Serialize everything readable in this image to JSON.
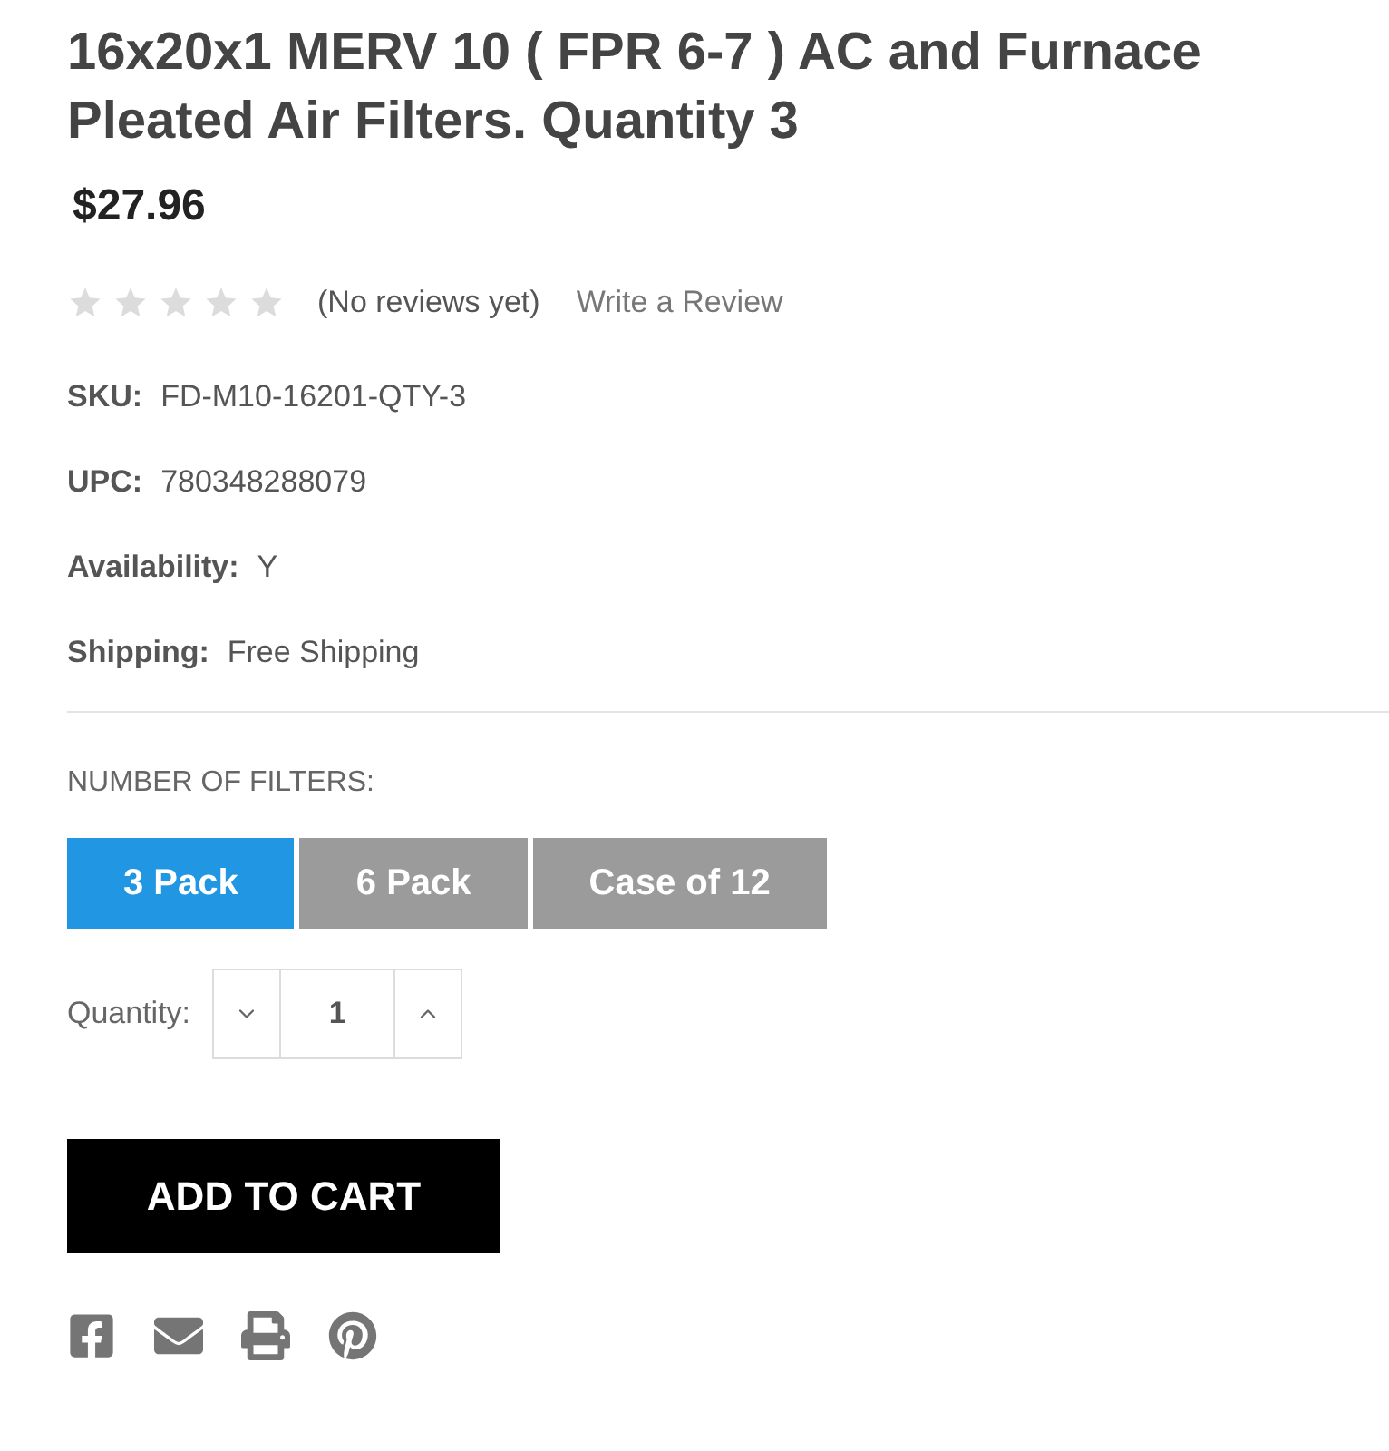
{
  "product": {
    "title": "16x20x1 MERV 10 ( FPR 6-7 ) AC and Furnace Pleated Air Filters. Quantity 3",
    "price": "$27.96"
  },
  "rating": {
    "stars": 0,
    "reviews": "(No reviews yet)",
    "write_review": "Write a Review"
  },
  "details": [
    {
      "label": "SKU:",
      "value": "FD-M10-16201-QTY-3"
    },
    {
      "label": "UPC:",
      "value": "780348288079"
    },
    {
      "label": "Availability:",
      "value": "Y"
    },
    {
      "label": "Shipping:",
      "value": "Free Shipping"
    }
  ],
  "options": {
    "label": "NUMBER OF FILTERS:",
    "choices": [
      {
        "label": "3 Pack",
        "selected": true
      },
      {
        "label": "6 Pack",
        "selected": false
      },
      {
        "label": "Case of 12",
        "selected": false
      }
    ]
  },
  "quantity": {
    "label": "Quantity:",
    "value": "1"
  },
  "add_to_cart": "ADD TO CART",
  "share_links": [
    {
      "kind": "facebook"
    },
    {
      "kind": "email"
    },
    {
      "kind": "print"
    },
    {
      "kind": "pinterest"
    }
  ]
}
